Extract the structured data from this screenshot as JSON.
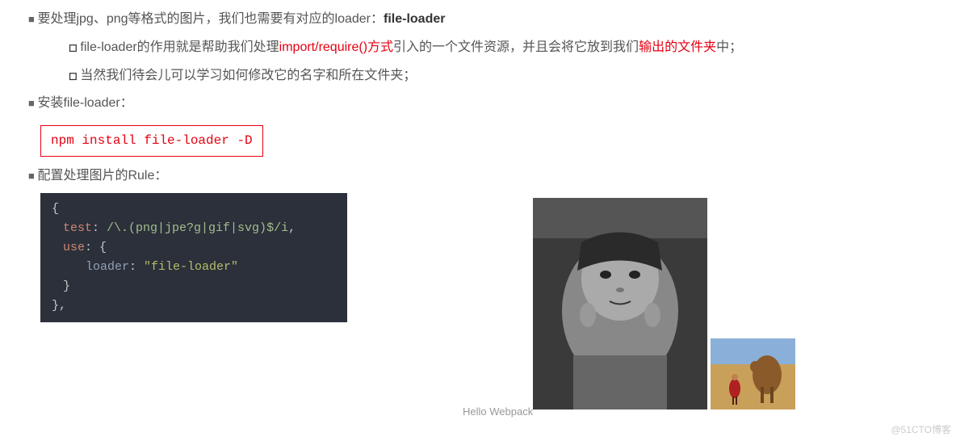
{
  "bullets": {
    "b1_pre": "要处理jpg、png等格式的图片，我们也需要有对应的loader：",
    "b1_bold": "file-loader",
    "b1_sub1_a": "file-loader的作用就是帮助我们处理",
    "b1_sub1_red1": "import/require()方式",
    "b1_sub1_b": "引入的一个文件资源，并且会将它放到我们",
    "b1_sub1_red2": "输出的文件夹",
    "b1_sub1_c": "中；",
    "b1_sub2": "当然我们待会儿可以学习如何修改它的名字和所在文件夹；",
    "b2": "安装file-loader：",
    "b3": "配置处理图片的Rule："
  },
  "npm_cmd": "npm install file-loader -D",
  "code": {
    "open": "{",
    "test_key": "test",
    "regex": "/\\.(png|jpe?g|gif|svg)$/i",
    "use_key": "use",
    "use_open": "{",
    "loader_key": "loader",
    "loader_val": "\"file-loader\"",
    "use_close": "}",
    "close": "},"
  },
  "hello": "Hello Webpack",
  "watermark": "@51CTO博客"
}
